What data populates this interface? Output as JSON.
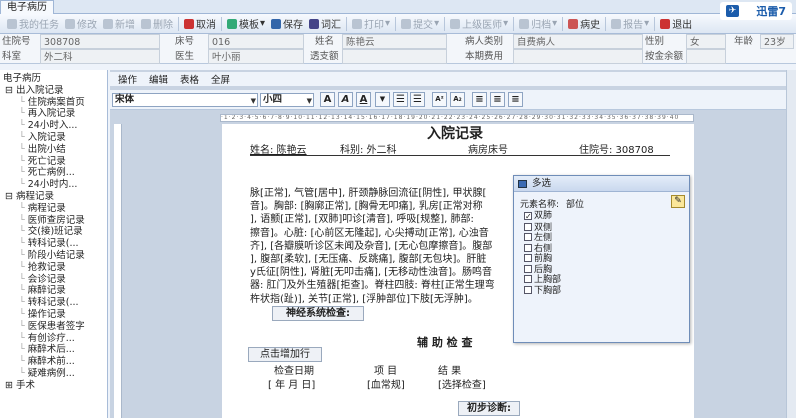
{
  "window": {
    "tab": "电子病历"
  },
  "toolbar": {
    "items": [
      {
        "label": "我的任务",
        "icon": "task-icon",
        "enabled": false
      },
      {
        "label": "修改",
        "icon": "edit-icon",
        "enabled": false
      },
      {
        "label": "新增",
        "icon": "add-icon",
        "enabled": false
      },
      {
        "label": "删除",
        "icon": "delete-icon",
        "enabled": false
      },
      {
        "label": "取消",
        "icon": "cancel-icon",
        "enabled": true
      },
      {
        "label": "模板",
        "icon": "template-icon",
        "enabled": true,
        "dropdown": true
      },
      {
        "label": "保存",
        "icon": "save-icon",
        "enabled": true
      },
      {
        "label": "词汇",
        "icon": "vocabulary-icon",
        "enabled": true
      },
      {
        "label": "打印",
        "icon": "print-icon",
        "enabled": false,
        "dropdown": true
      },
      {
        "label": "提交",
        "icon": "submit-icon",
        "enabled": false,
        "dropdown": true
      },
      {
        "label": "上级医师",
        "icon": "doctor-icon",
        "enabled": false,
        "dropdown": true
      },
      {
        "label": "归档",
        "icon": "archive-icon",
        "enabled": false,
        "dropdown": true
      },
      {
        "label": "病史",
        "icon": "history-icon",
        "enabled": true
      },
      {
        "label": "报告",
        "icon": "report-icon",
        "enabled": false,
        "dropdown": true
      },
      {
        "label": "退出",
        "icon": "exit-icon",
        "enabled": true
      }
    ],
    "brand": "迅雷7"
  },
  "patient": {
    "row1": [
      {
        "label": "住院号",
        "value": "308708"
      },
      {
        "label": "床号",
        "value": "016"
      },
      {
        "label": "姓名",
        "value": "陈艳云"
      },
      {
        "label": "病人类别",
        "value": "自费病人"
      },
      {
        "label": "性别",
        "value": "女"
      },
      {
        "label": "年龄",
        "value": "23岁"
      }
    ],
    "row2": [
      {
        "label": "科室",
        "value": "外二科"
      },
      {
        "label": "医生",
        "value": "叶小丽"
      },
      {
        "label": "透支额",
        "value": ""
      },
      {
        "label": "本期费用",
        "value": ""
      },
      {
        "label": "按金余额",
        "value": ""
      }
    ]
  },
  "tree": {
    "title": "电子病历",
    "items": [
      {
        "label": "出入院记录",
        "level": 1,
        "toggle": "⊟"
      },
      {
        "label": "住院病案首页",
        "level": 2
      },
      {
        "label": "再入院记录",
        "level": 2
      },
      {
        "label": "24小时入...",
        "level": 2
      },
      {
        "label": "入院记录",
        "level": 2
      },
      {
        "label": "出院小结",
        "level": 2
      },
      {
        "label": "死亡记录",
        "level": 2
      },
      {
        "label": "死亡病例...",
        "level": 2
      },
      {
        "label": "24小时内...",
        "level": 2
      },
      {
        "label": "病程记录",
        "level": 1,
        "toggle": "⊟"
      },
      {
        "label": "病程记录",
        "level": 2
      },
      {
        "label": "医师查房记录",
        "level": 2
      },
      {
        "label": "交(接)班记录",
        "level": 2
      },
      {
        "label": "转科记录(...",
        "level": 2
      },
      {
        "label": "阶段小结记录",
        "level": 2
      },
      {
        "label": "抢救记录",
        "level": 2
      },
      {
        "label": "会诊记录",
        "level": 2
      },
      {
        "label": "麻醉记录",
        "level": 2
      },
      {
        "label": "转科记录(...",
        "level": 2
      },
      {
        "label": "操作记录",
        "level": 2
      },
      {
        "label": "医保患者签字",
        "level": 2
      },
      {
        "label": "有创诊疗...",
        "level": 2
      },
      {
        "label": "麻醉术后...",
        "level": 2
      },
      {
        "label": "麻醉术前...",
        "level": 2
      },
      {
        "label": "疑难病例...",
        "level": 2
      },
      {
        "label": "手术",
        "level": 1,
        "toggle": "⊞"
      }
    ]
  },
  "editor_menu": [
    "操作",
    "编辑",
    "表格",
    "全屏"
  ],
  "format": {
    "font": "宋体",
    "size": "小四",
    "buttons": [
      "A",
      "A",
      "A"
    ]
  },
  "doc": {
    "title": "入院记录",
    "header": {
      "name": "姓名: 陈艳云",
      "dept": "科别: 外二科",
      "bed": "病房床号",
      "inpatient": "住院号: 308708"
    },
    "lines": [
      "脉[正常], 气管[居中], 肝颈静脉回流征[阴性], 甲状腺[",
      "音]。胸部: [胸廓正常], [胸骨无叩痛], 乳房[正常对称",
      "], 语颤[正常], [双肺]叩诊[清音], 呼吸[规整], 肺部:",
      "擦音]。心脏: [心前区无隆起], 心尖搏动[正常], 心浊音",
      "齐], [各瓣膜听诊区未闻及杂音], [无心包摩擦音]。腹部",
      "], 腹部[柔软], [无压痛、反跳痛], 腹部[无包块]。肝脏",
      "y氏征[阴性], 肾脏[无叩击痛], [无移动性浊音]。肠鸣音",
      "器: 肛门及外生殖器[拒查]。脊柱四肢: 脊柱[正常生理弯",
      "杵状指(趾)], 关节[正常], [浮肿部位]下肢[无浮肿]。"
    ],
    "neuro_btn": "神经系统检查:",
    "aux_title": "辅  助  检  查",
    "add_row_btn": "点击增加行",
    "cols": [
      "检查日期",
      "项  目",
      "结  果"
    ],
    "row": [
      "[ 年 月 日]",
      "[血常规]",
      "[选择检查]"
    ],
    "diagnosis_btn": "初步诊断:"
  },
  "dialog": {
    "title": "多选",
    "field_label": "元素名称:",
    "field_value": "部位",
    "options": [
      {
        "label": "双肺",
        "checked": true
      },
      {
        "label": "双侧",
        "checked": false
      },
      {
        "label": "左侧",
        "checked": false
      },
      {
        "label": "右侧",
        "checked": false
      },
      {
        "label": "前胸",
        "checked": false
      },
      {
        "label": "后胸",
        "checked": false
      },
      {
        "label": "上胸部",
        "checked": false
      },
      {
        "label": "下胸部",
        "checked": false
      }
    ]
  }
}
